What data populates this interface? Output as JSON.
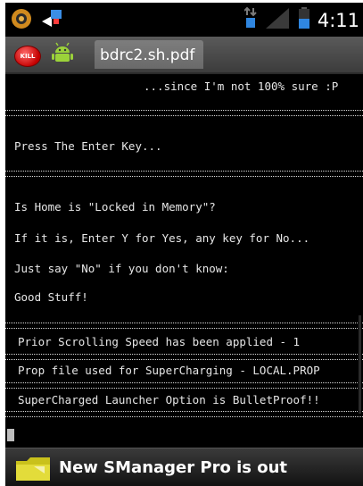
{
  "status_bar": {
    "time": "4:11",
    "icons": [
      "app-icon",
      "notification-icon",
      "data-transfer-icon",
      "signal-icon",
      "battery-icon"
    ]
  },
  "toolbar": {
    "kill_label": "KILL",
    "tab_title": "bdrc2.sh.pdf"
  },
  "terminal": {
    "lines": [
      "...since I'm not 100% sure :P",
      "Press The Enter Key...",
      "Is Home is \"Locked in Memory\"?",
      "If it is, Enter Y for Yes, any key for No...",
      "Just say \"No\" if you don't know:",
      "Good Stuff!",
      "Prior Scrolling Speed has been applied - 1",
      "Prop file used for SuperCharging - LOCAL.PROP",
      "SuperCharged Launcher Option is BulletProof!!"
    ]
  },
  "notification": {
    "text": "New SManager Pro is out",
    "icon": "folder-icon"
  },
  "colors": {
    "terminal_bg": "#000000",
    "terminal_fg": "#e6e6e6",
    "toolbar": "#4a4a4a",
    "kill": "#c40000",
    "android": "#9bd23a",
    "battery": "#2f86e0"
  }
}
